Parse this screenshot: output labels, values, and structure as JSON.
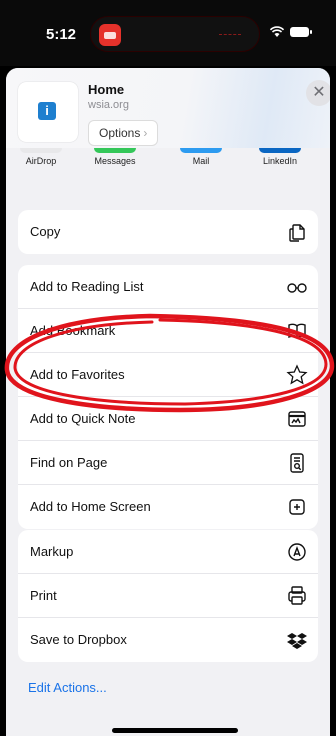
{
  "status": {
    "time": "5:12"
  },
  "header": {
    "title": "Home",
    "url": "wsia.org",
    "options_label": "Options",
    "options_chevron": "›",
    "close_glyph": "✕",
    "app_icon_glyph": "i"
  },
  "apps": [
    {
      "label": "AirDrop",
      "color": "#e8e8ea"
    },
    {
      "label": "Messages",
      "color": "#34c759"
    },
    {
      "label": "Mail",
      "color": "#2d9bf0"
    },
    {
      "label": "LinkedIn",
      "color": "#0a66c2"
    }
  ],
  "groups": {
    "copy": {
      "items": [
        {
          "label": "Copy",
          "icon": "copy-icon"
        }
      ]
    },
    "actions": {
      "items": [
        {
          "label": "Add to Reading List",
          "icon": "glasses-icon"
        },
        {
          "label": "Add Bookmark",
          "icon": "book-icon"
        },
        {
          "label": "Add to Favorites",
          "icon": "star-icon"
        },
        {
          "label": "Add to Quick Note",
          "icon": "quick-note-icon"
        },
        {
          "label": "Find on Page",
          "icon": "find-document-icon"
        },
        {
          "label": "Add to Home Screen",
          "icon": "add-square-icon"
        }
      ]
    },
    "extras": {
      "items": [
        {
          "label": "Markup",
          "icon": "markup-icon"
        },
        {
          "label": "Print",
          "icon": "printer-icon"
        },
        {
          "label": "Save to Dropbox",
          "icon": "dropbox-icon"
        }
      ]
    }
  },
  "edit_actions_label": "Edit Actions...",
  "annotation": {
    "color": "#e0141c"
  }
}
